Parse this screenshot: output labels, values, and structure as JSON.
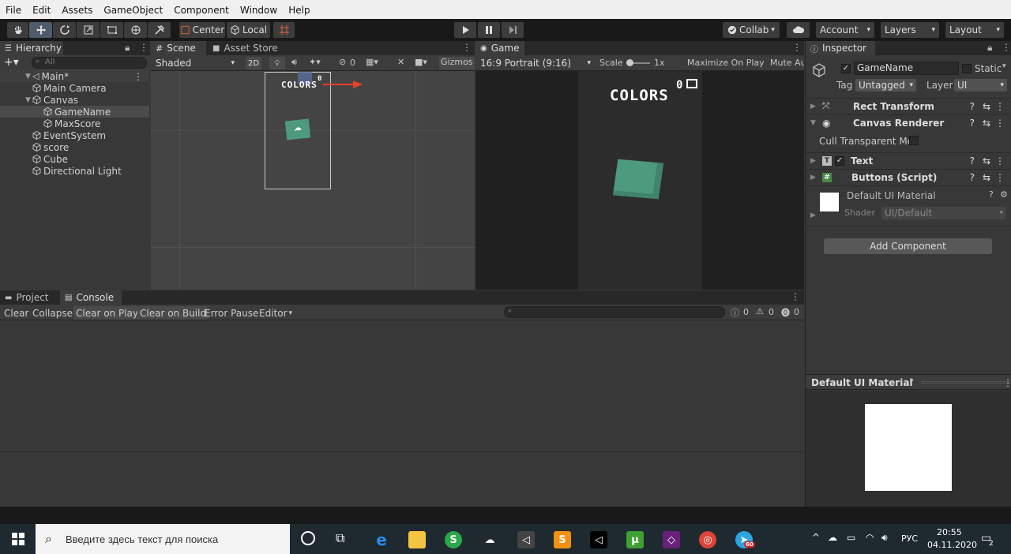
{
  "menu": [
    "File",
    "Edit",
    "Assets",
    "GameObject",
    "Component",
    "Window",
    "Help"
  ],
  "toolbar": {
    "pivot_center": "Center",
    "pivot_local": "Local",
    "collab": "Collab",
    "account": "Account",
    "layers": "Layers",
    "layout": "Layout"
  },
  "hierarchy": {
    "tab": "Hierarchy",
    "search_placeholder": "All",
    "scene_name": "Main*",
    "items": [
      {
        "label": "Main Camera",
        "depth": 1,
        "arrow": ""
      },
      {
        "label": "Canvas",
        "depth": 1,
        "arrow": "▼"
      },
      {
        "label": "GameName",
        "depth": 2,
        "arrow": "",
        "selected": true
      },
      {
        "label": "MaxScore",
        "depth": 2,
        "arrow": ""
      },
      {
        "label": "EventSystem",
        "depth": 1,
        "arrow": ""
      },
      {
        "label": "score",
        "depth": 1,
        "arrow": ""
      },
      {
        "label": "Cube",
        "depth": 1,
        "arrow": ""
      },
      {
        "label": "Directional Light",
        "depth": 1,
        "arrow": ""
      }
    ]
  },
  "scene": {
    "tab_scene": "Scene",
    "tab_asset_store": "Asset Store",
    "shading": "Shaded",
    "mode_2d": "2D",
    "hidden_count": "0",
    "gizmos": "Gizmos",
    "canvas_title": "COLORS",
    "canvas_score": "0"
  },
  "game": {
    "tab": "Game",
    "aspect": "16:9 Portrait (9:16)",
    "scale_label": "Scale",
    "scale_value": "1x",
    "maximize": "Maximize On Play",
    "mute": "Mute Au",
    "title": "COLORS",
    "score": "0"
  },
  "inspector": {
    "tab": "Inspector",
    "object_name": "GameName",
    "static_label": "Static",
    "tag_label": "Tag",
    "tag_value": "Untagged",
    "layer_label": "Layer",
    "layer_value": "UI",
    "components": [
      "Rect Transform",
      "Canvas Renderer",
      "Text",
      "Buttons (Script)"
    ],
    "cull_label": "Cull Transparent Mes",
    "material_name": "Default UI Material",
    "shader_label": "Shader",
    "shader_value": "UI/Default",
    "add_component": "Add Component",
    "preview_title": "Default UI Material"
  },
  "bottom": {
    "tab_project": "Project",
    "tab_console": "Console",
    "buttons": [
      "Clear",
      "Collapse",
      "Clear on Play",
      "Clear on Build",
      "Error Pause",
      "Editor"
    ],
    "log_count": "0",
    "warn_count": "0",
    "error_count": "0"
  },
  "taskbar": {
    "search_placeholder": "Введите здесь текст для поиска",
    "lang": "РУС",
    "time": "20:55",
    "date": "04.11.2020",
    "notif_count": "2",
    "telegram_badge": "60"
  },
  "colors": {
    "accent_cube": "#4e9a7e",
    "selection": "#4b4b4b",
    "panel": "#383838"
  }
}
